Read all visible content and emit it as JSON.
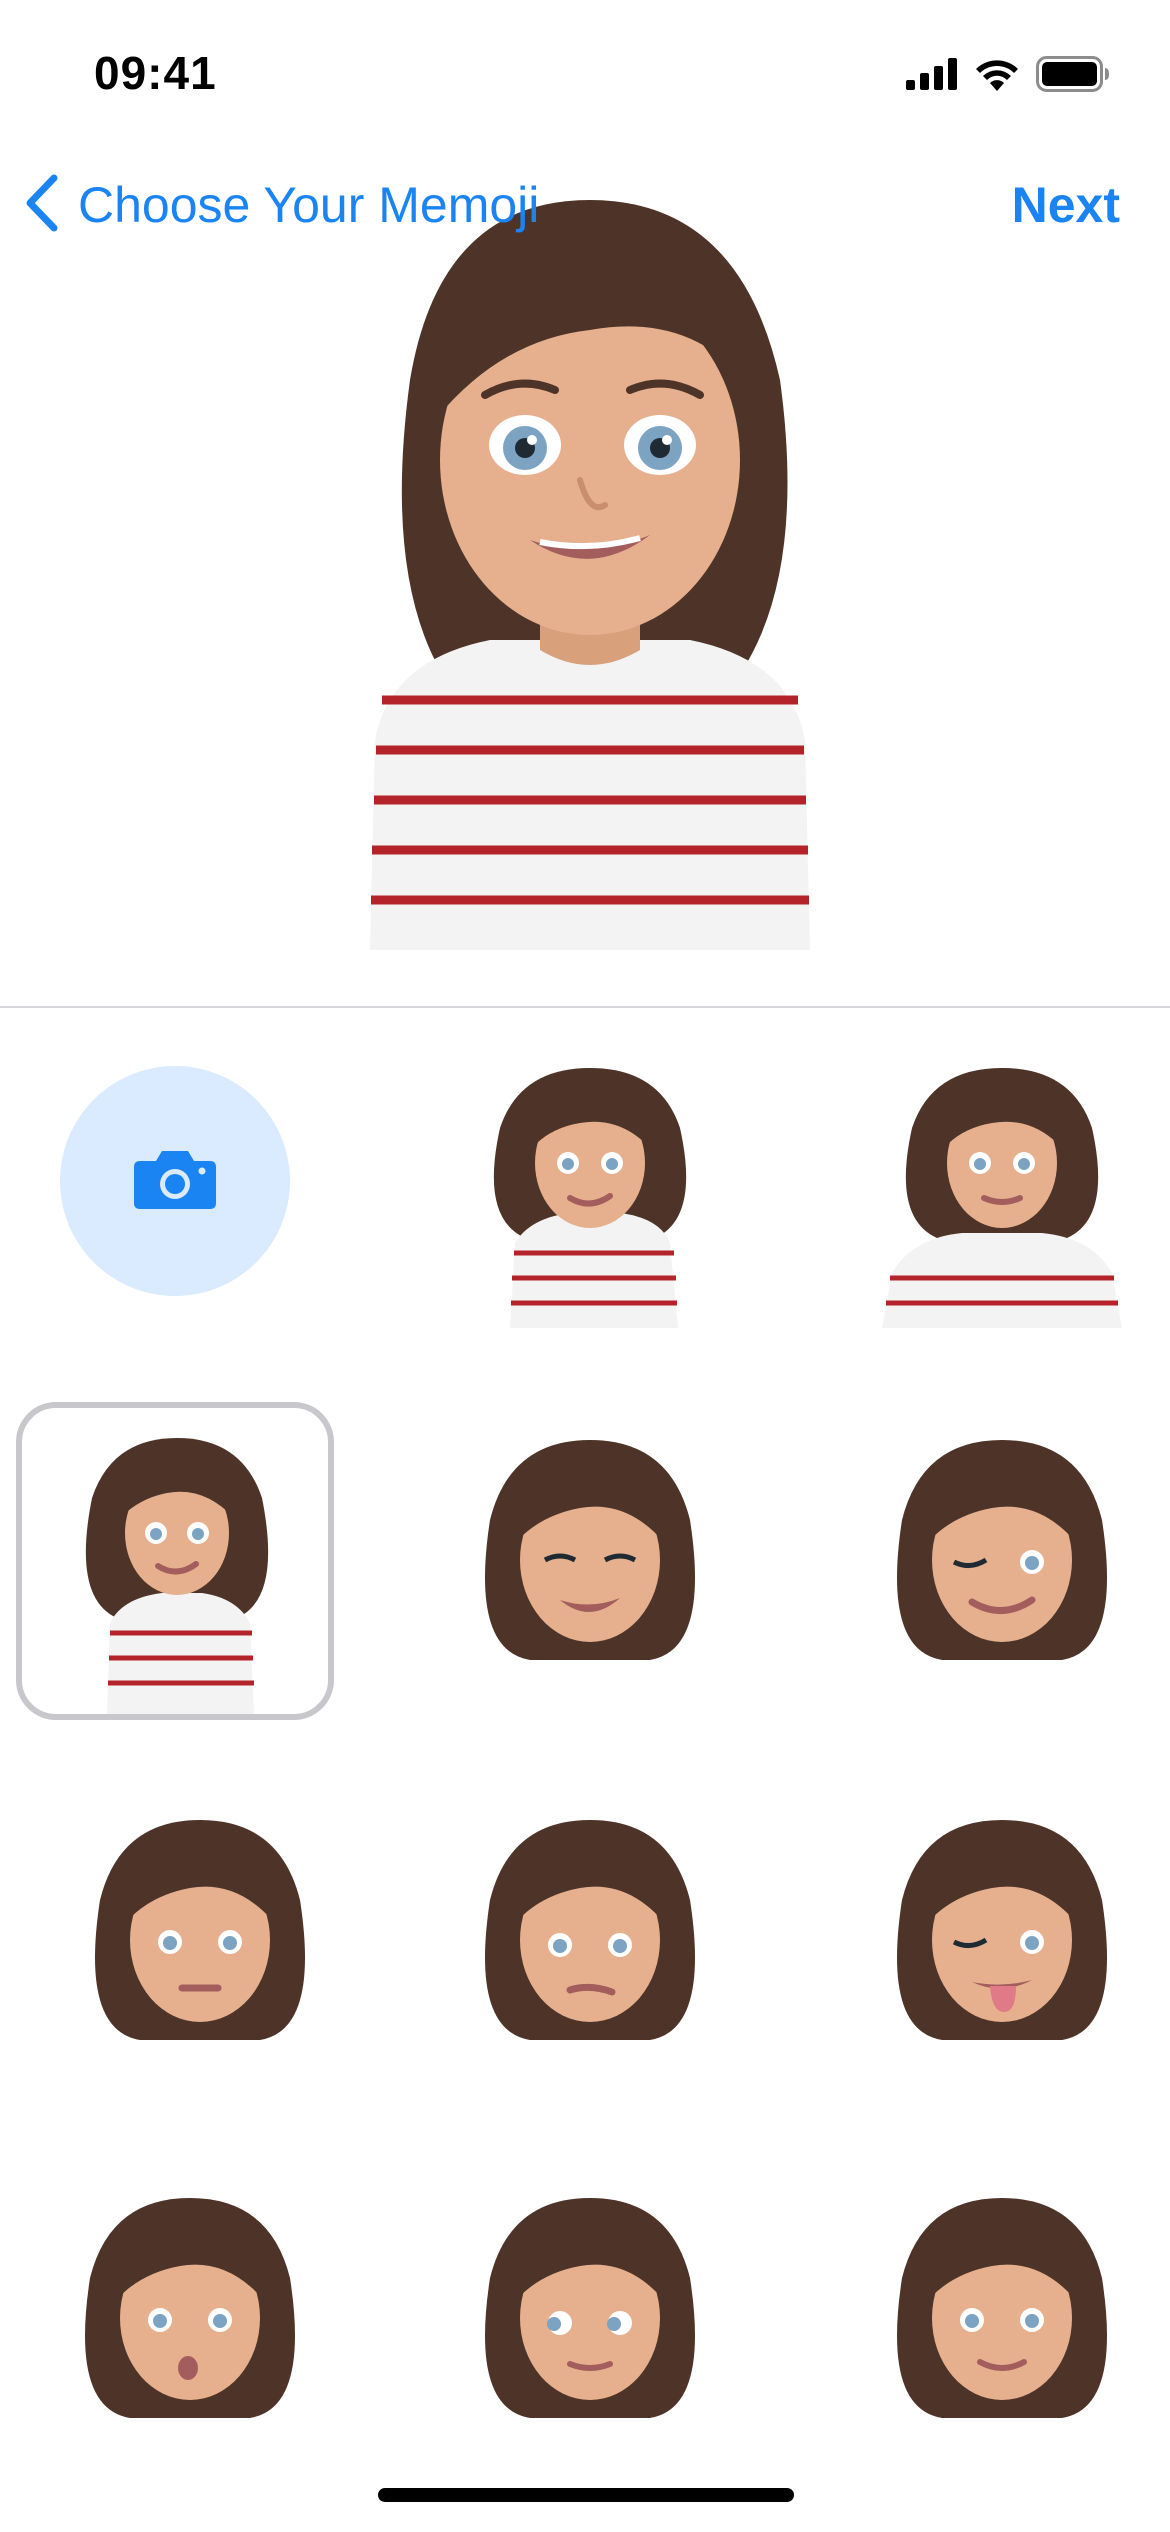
{
  "status_bar": {
    "time": "09:41",
    "icons": [
      "cellular-signal-icon",
      "wifi-icon",
      "battery-icon"
    ]
  },
  "nav": {
    "back_icon": "chevron-left-icon",
    "title": "Choose Your Memoji",
    "next_label": "Next"
  },
  "colors": {
    "accent": "#1a84f2",
    "camera_bg": "#daeaff",
    "hair": "#4e3428",
    "skin": "#e6b08f",
    "iris": "#7da3c3",
    "stripe": "#b4232a",
    "shirt": "#f3f3f3"
  },
  "grid": {
    "camera_icon": "camera-icon",
    "selected_index": 3,
    "poses": [
      "camera",
      "upper-body-smile",
      "hands-on-hips",
      "upper-body-selected",
      "head-grin",
      "head-wink",
      "head-neutral",
      "head-unsure",
      "head-tongue-out-wink",
      "head-kiss",
      "head-side-glance",
      "head-calm-smile"
    ]
  }
}
